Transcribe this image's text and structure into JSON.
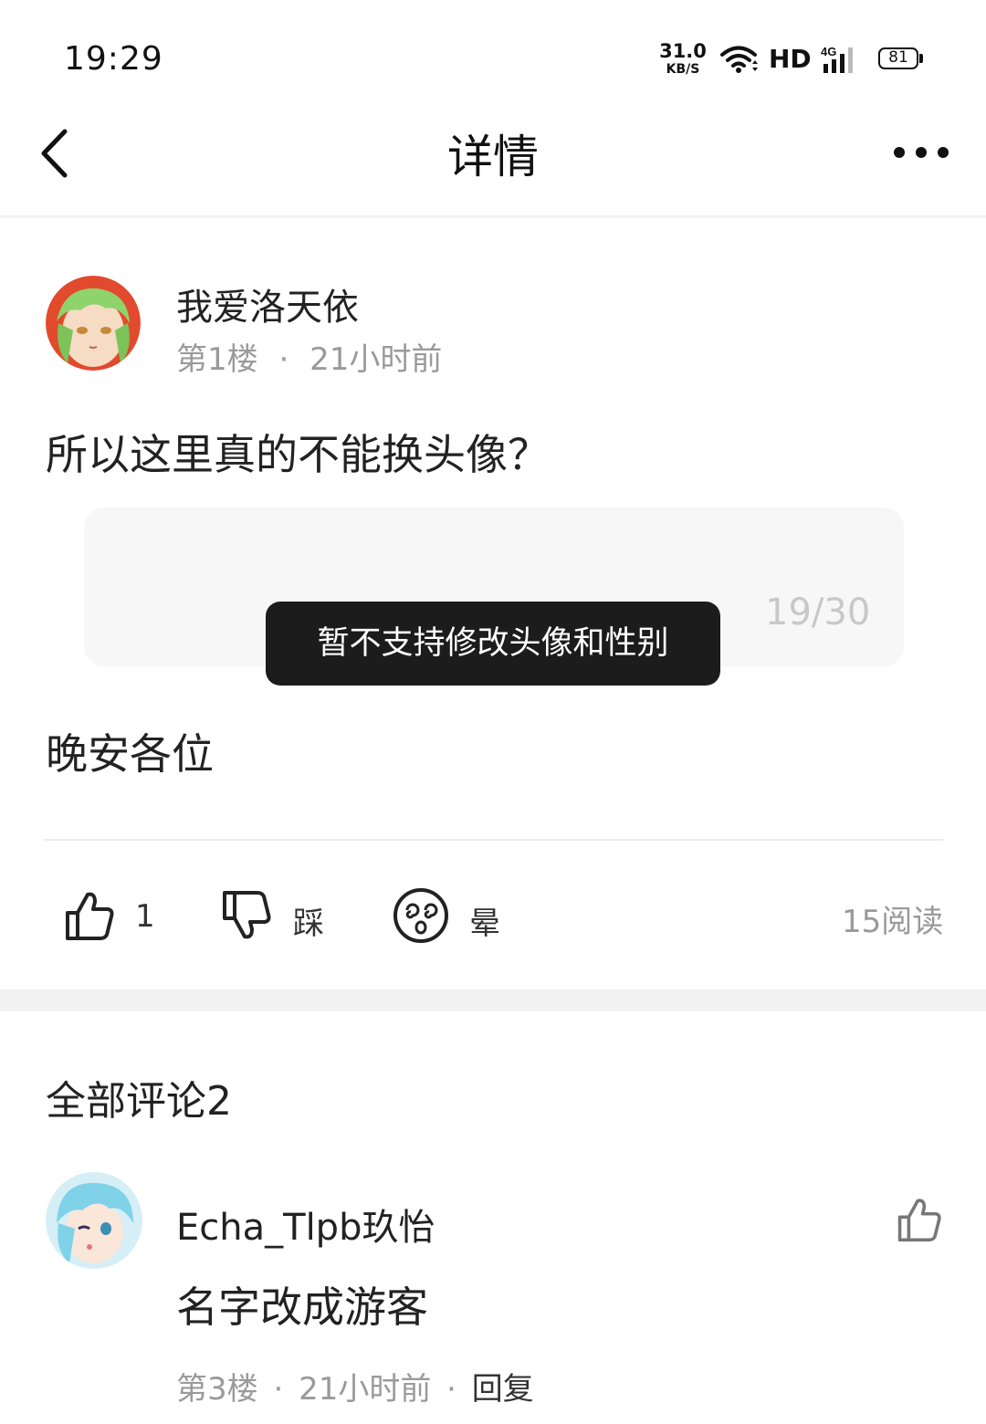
{
  "status_bar": {
    "time": "19:29",
    "net_speed_value": "31.0",
    "net_speed_unit": "KB/S",
    "hd": "HD",
    "network": "4G",
    "battery": "81",
    "icons": [
      "wifi-icon",
      "signal-icon",
      "battery-icon"
    ]
  },
  "nav": {
    "title": "详情",
    "back_icon": "chevron-left-icon",
    "more_icon": "more-dots-icon"
  },
  "post": {
    "author": "我爱洛天依",
    "floor": "第1楼",
    "dot": "·",
    "time": "21小时前",
    "body": "所以这里真的不能换头像？",
    "input_char_count": "19/30",
    "body2": "晚安各位",
    "actions": {
      "like_count": "1",
      "dislike_label": "踩",
      "dizzy_label": "晕",
      "read_count": "15阅读"
    }
  },
  "toast": {
    "message": "暂不支持修改头像和性别"
  },
  "comments": {
    "title": "全部评论2",
    "items": [
      {
        "author": "Echa_Tlpb玖怡",
        "text": "名字改成游客",
        "floor": "第3楼",
        "time": "21小时前",
        "reply": "回复"
      }
    ]
  }
}
